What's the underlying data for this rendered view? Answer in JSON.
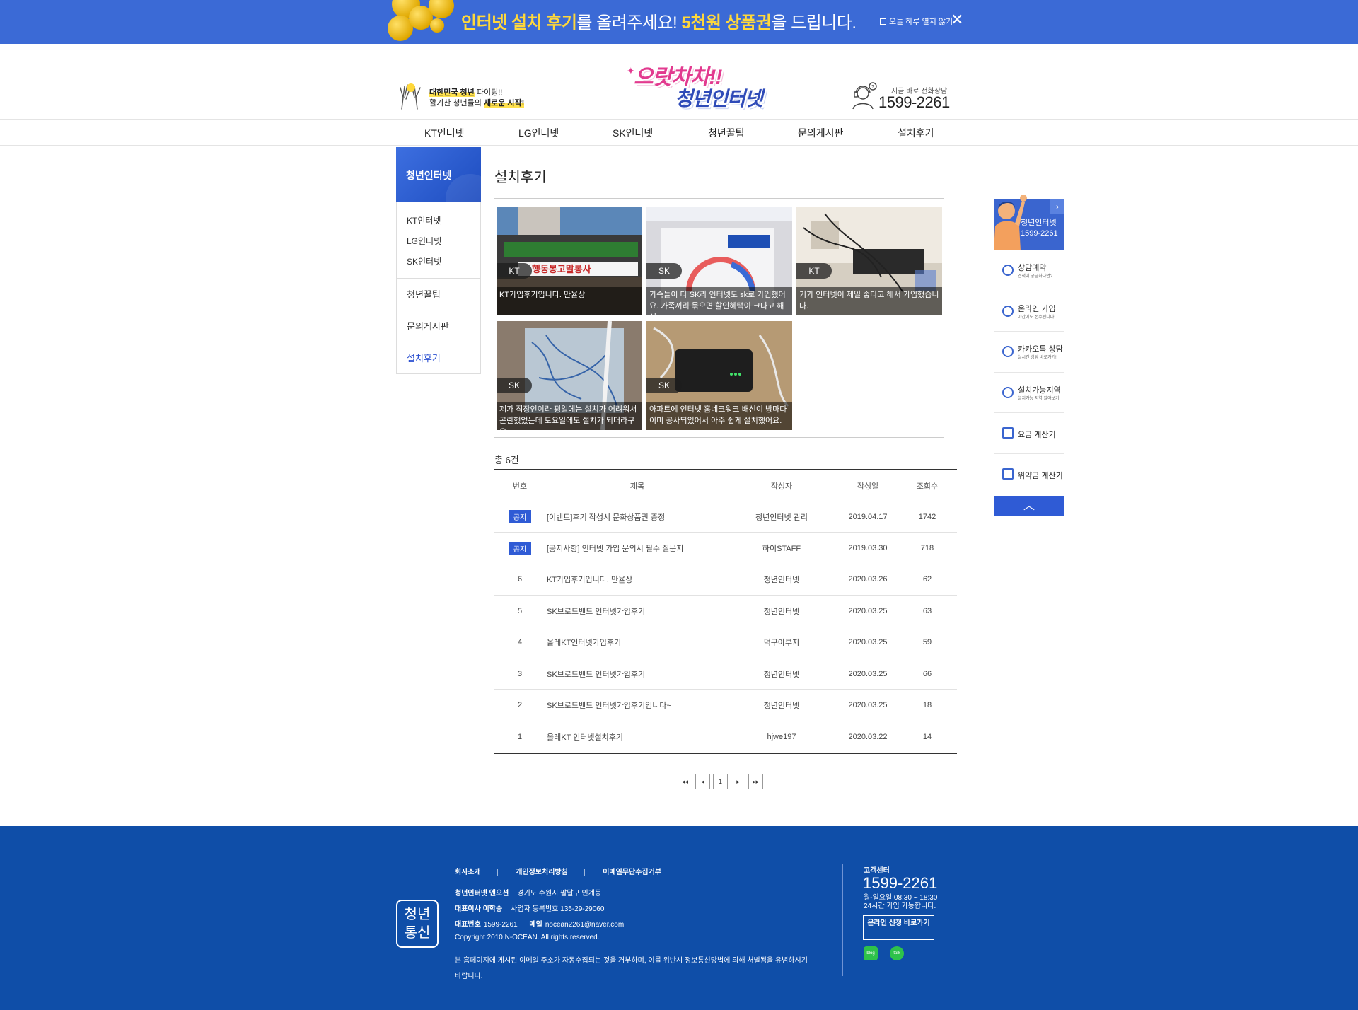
{
  "banner": {
    "t1": "인터넷 설치 후기",
    "t2": "를 올려주세요!",
    "t3": "5천원 상품권",
    "t4": "을 드립니다.",
    "today": "오늘 하루 열지 않기",
    "close": "✕"
  },
  "header": {
    "slogan_y1": "대한민국 청년",
    "slogan_n1": " 파이팅!!",
    "slogan_n2": "활기찬 청년들의 ",
    "slogan_y2": "새로운 시작!",
    "logo_l1": "으랏차차!!",
    "logo_l2": "청년인터넷",
    "phone_caption": "지금 바로 전화상담",
    "phone_number": "1599-2261"
  },
  "gnb": [
    "KT인터넷",
    "LG인터넷",
    "SK인터넷",
    "청년꿀팁",
    "문의게시판",
    "설치후기"
  ],
  "lnb": {
    "title": "청년인터넷",
    "subs": [
      "KT인터넷",
      "LG인터넷",
      "SK인터넷"
    ],
    "items": [
      "청년꿀팁",
      "문의게시판",
      "설치후기"
    ]
  },
  "page": {
    "title": "설치후기",
    "total": "총 6건"
  },
  "gallery": [
    {
      "badge": "KT",
      "caption": "KT가입후기입니다. 만율상"
    },
    {
      "badge": "SK",
      "caption": "가족들이 다 SK라 인터넷도 sk로 가입했어요. 가족끼리 묶으면 할인혜택이 크다고 해서..."
    },
    {
      "badge": "KT",
      "caption": "기가 인터넷이 제일 좋다고 해서 가입했습니다."
    },
    {
      "badge": "SK",
      "caption": "제가 직장인이라 평일에는 설치가 어려워서 곤란했었는데 토요일에도 설치가 되더라구요. ~"
    },
    {
      "badge": "SK",
      "caption": "아파트에 인터넷 홈네크워크 배선이 방마다 이미 공사되있어서 아주 쉽게 설치했어요."
    }
  ],
  "board": {
    "headers": {
      "num": "번호",
      "title": "제목",
      "writer": "작성자",
      "date": "작성일",
      "hits": "조회수"
    },
    "rows": [
      {
        "num": "공지",
        "title": "[이벤트]후기 작성시 문화상품권 증정",
        "writer": "청년인터넷 관리",
        "date": "2019.04.17",
        "hits": "1742"
      },
      {
        "num": "공지",
        "title": "[공지사항] 인터넷 가입 문의시 필수 질문지",
        "writer": "하이STAFF",
        "date": "2019.03.30",
        "hits": "718"
      },
      {
        "num": "6",
        "title": "KT가입후기입니다. 만율상",
        "writer": "청년인터넷",
        "date": "2020.03.26",
        "hits": "62"
      },
      {
        "num": "5",
        "title": "SK브로드밴드 인터넷가입후기",
        "writer": "청년인터넷",
        "date": "2020.03.25",
        "hits": "63"
      },
      {
        "num": "4",
        "title": "올레KT인터넷가입후기",
        "writer": "덕구아부지",
        "date": "2020.03.25",
        "hits": "59"
      },
      {
        "num": "3",
        "title": "SK브로드밴드 인터넷가입후기",
        "writer": "청년인터넷",
        "date": "2020.03.25",
        "hits": "66"
      },
      {
        "num": "2",
        "title": "SK브로드밴드 인터넷가입후기입니다~",
        "writer": "청년인터넷",
        "date": "2020.03.25",
        "hits": "18"
      },
      {
        "num": "1",
        "title": "올레KT 인터넷설치후기",
        "writer": "hjwe197",
        "date": "2020.03.22",
        "hits": "14"
      }
    ]
  },
  "pager": {
    "first": "◂◂",
    "prev": "◂",
    "page": "1",
    "next": "▸",
    "last": "▸▸"
  },
  "quick": {
    "label1": "청년인터넷",
    "label2": "1599-2261",
    "items": [
      {
        "t1": "상담예약",
        "t2": "견적이 궁금하다면?"
      },
      {
        "t1": "온라인 가입",
        "t2": "야간에도 접수됩니다!"
      },
      {
        "t1": "카카오톡 상담",
        "t2": "실시간 상담 바로가기!"
      },
      {
        "t1": "설치가능지역",
        "t2": "설치가능 지역 알아보기"
      },
      {
        "t1": "요금 계산기",
        "t2": ""
      },
      {
        "t1": "위약금 계산기",
        "t2": ""
      }
    ]
  },
  "footer": {
    "logo1": "청년",
    "logo2": "통신",
    "links": [
      "회사소개",
      "개인정보처리방침",
      "이메일무단수집거부"
    ],
    "company_k": "청년인터넷 엔오션",
    "company_v": "경기도 수원시 팔달구 인계동",
    "ceo_k": "대표이사 이학승",
    "ceo_v": "사업자 등록번호 135-29-29060",
    "tel_k": "대표번호",
    "tel_v": "1599-2261",
    "mail_k": "메일",
    "mail_v": "nocean2261@naver.com",
    "copyright": "Copyright 2010 N-OCEAN. All rights reserved.",
    "notice": "본 홈페이지에 게시된 이메일 주소가 자동수집되는 것을 거부하며, 이를 위반시 정보통신망법에 의해 처벌됨을 유념하시기 바랍니다.",
    "cs_title": "고객센터",
    "cs_number": "1599-2261",
    "cs_hours1": "월-일요일 08:30 ~ 18:30",
    "cs_hours2": "24시간 가입 가능합니다.",
    "cs_button": "온라인 신청 바로가기",
    "icon_blog": "blog",
    "icon_kakao": "talk"
  }
}
